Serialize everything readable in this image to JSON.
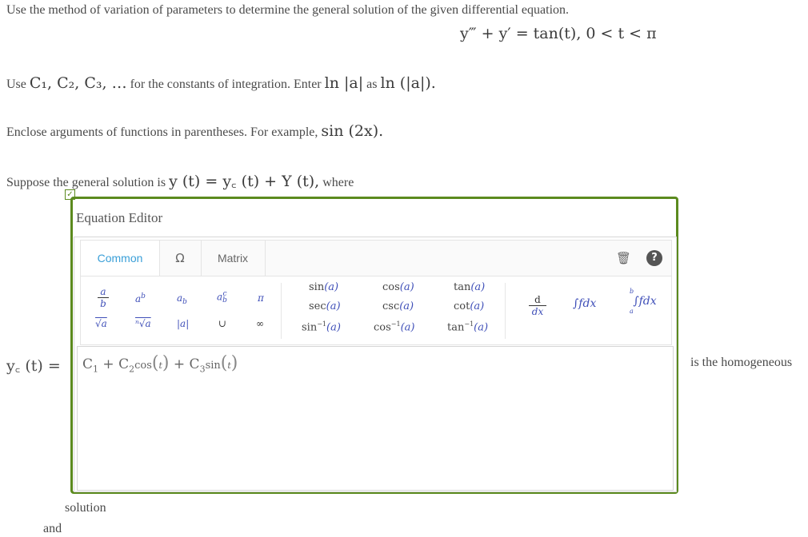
{
  "instructions": {
    "line1": "Use the method of variation of parameters to determine the general solution of the given differential equation.",
    "equation": "y‴ + y′ = tan(t), 0 < t < π",
    "line2_prefix": "Use",
    "constants": "C₁, C₂, C₃, …",
    "line2_mid": "for the constants of integration. Enter",
    "ln_abs": "ln |a|",
    "line2_as": "as",
    "ln_paren": "ln (|a|).",
    "line3_prefix": "Enclose arguments of functions in parentheses. For example,",
    "sin_example": "sin (2x).",
    "line4_prefix": "Suppose the general solution is",
    "general_solution": "y (t) = y꜀ (t) + Y (t),",
    "line4_suffix": "where"
  },
  "editor": {
    "title": "Equation Editor",
    "tabs": [
      "Common",
      "Ω",
      "Matrix"
    ],
    "active_tab": "Common",
    "functions": {
      "sin": "sin",
      "cos": "cos",
      "tan": "tan",
      "sec": "sec",
      "csc": "csc",
      "cot": "cot",
      "asin": "sin",
      "acos": "cos",
      "atan": "tan",
      "inv": "−1",
      "arg": "(a)"
    },
    "palette": {
      "frac_num": "a",
      "frac_den": "b",
      "pow_base": "a",
      "pow_exp": "b",
      "sub_base": "a",
      "sub_idx": "b",
      "subsup_base": "a",
      "subsup_sup": "c",
      "subsup_sub": "b",
      "pi": "π",
      "sqrt": "√a",
      "nroot": "ⁿ√a",
      "abs": "|a|",
      "union": "∪",
      "infinity": "∞",
      "deriv_top": "d",
      "deriv_bot": "dx",
      "integral": "∫fdx",
      "def_integral_upper": "b",
      "def_integral_lower": "a"
    },
    "value": {
      "c1": "C",
      "c1_sub": "1",
      "plus1": "+",
      "c2": "C",
      "c2_sub": "2",
      "cos": "cos",
      "t1": "t",
      "plus2": "+",
      "c3": "C",
      "c3_sub": "3",
      "sin": "sin",
      "t2": "t"
    }
  },
  "yc_label": "y꜀ (t) =",
  "after_editor": "is the homogeneous",
  "solution_text": "solution",
  "and_text": "and"
}
